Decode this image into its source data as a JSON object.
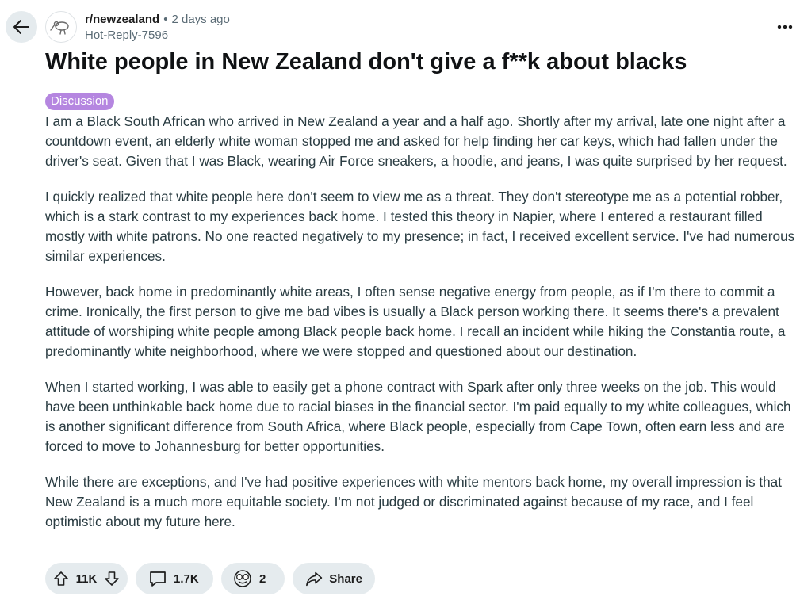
{
  "header": {
    "subreddit": "r/newzealand",
    "separator": "•",
    "time": "2 days ago",
    "username": "Hot-Reply-7596"
  },
  "post": {
    "title": "White people in New Zealand don't give a f**k about blacks",
    "flair": "Discussion",
    "paragraphs": [
      "I am a Black South African who arrived in New Zealand a year and a half ago. Shortly after my arrival, late one night after a countdown event, an elderly white woman stopped me and asked for help finding her car keys, which had fallen under the driver's seat. Given that I was Black, wearing Air Force sneakers, a hoodie, and jeans, I was quite surprised by her request.",
      "I quickly realized that white people here don't seem to view me as a threat. They don't stereotype me as a potential robber, which is a stark contrast to my experiences back home. I tested this theory in Napier, where I entered a restaurant filled mostly with white patrons. No one reacted negatively to my presence; in fact, I received excellent service. I've had numerous similar experiences.",
      "However, back home in predominantly white areas, I often sense negative energy from people, as if I'm there to commit a crime. Ironically, the first person to give me bad vibes is usually a Black person working there. It seems there's a prevalent attitude of worshiping white people among Black people back home. I recall an incident while hiking the Constantia route, a predominantly white neighborhood, where we were stopped and questioned about our destination.",
      "When I started working, I was able to easily get a phone contract with Spark after only three weeks on the job. This would have been unthinkable back home due to racial biases in the financial sector. I'm paid equally to my white colleagues, which is another significant difference from South Africa, where Black people, especially from Cape Town, often earn less and are forced to move to Johannesburg for better opportunities.",
      "While there are exceptions, and I've had positive experiences with white mentors back home, my overall impression is that New Zealand is a much more equitable society. I'm not judged or discriminated against because of my race, and I feel optimistic about my future here."
    ]
  },
  "actions": {
    "votes": "11K",
    "comments": "1.7K",
    "awards": "2",
    "share_label": "Share"
  },
  "icons": {
    "back": "arrow-left-icon",
    "more": "ellipsis-horizontal-icon",
    "upvote": "arrow-up-icon",
    "downvote": "arrow-down-icon",
    "comment": "speech-bubble-icon",
    "award": "award-face-icon",
    "share": "share-arrow-icon"
  },
  "colors": {
    "flair_bg": "#b586e0",
    "pill_bg": "#e5ebee",
    "body_text": "#2a3c42",
    "meta_text": "#5a6b75"
  }
}
